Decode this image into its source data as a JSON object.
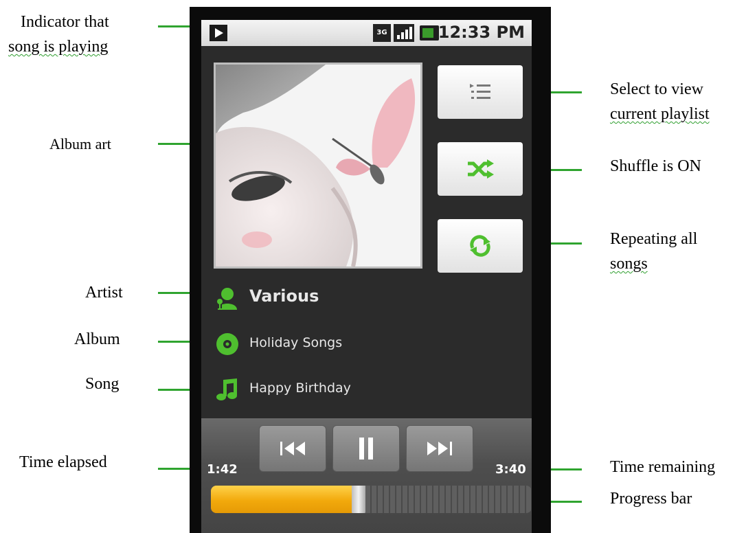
{
  "annotations": {
    "playing_indicator": [
      "Indicator that",
      "song is playing"
    ],
    "album_art": "Album art",
    "artist": "Artist",
    "album": "Album",
    "song": "Song",
    "time_elapsed": "Time elapsed",
    "playlist": [
      "Select to view",
      "current playlist"
    ],
    "shuffle": "Shuffle is ON",
    "repeat": [
      "Repeating all",
      "songs"
    ],
    "time_remaining": "Time remaining",
    "progress_bar": "Progress bar"
  },
  "status_bar": {
    "network": "3G",
    "time": "12:33 PM"
  },
  "now_playing": {
    "artist": "Various",
    "album": "Holiday Songs",
    "song": "Happy Birthday"
  },
  "playback": {
    "elapsed": "1:42",
    "remaining": "3:40",
    "progress_fraction": 0.46,
    "state": "playing"
  },
  "side_buttons": {
    "playlist_icon": "playlist-icon",
    "shuffle_icon": "shuffle-icon",
    "repeat_icon": "repeat-icon",
    "shuffle_on": true,
    "repeat_all": true
  },
  "colors": {
    "accent_green": "#4fbf2f",
    "progress_orange": "#f2a90c",
    "annotation_line": "#2fa42f"
  }
}
